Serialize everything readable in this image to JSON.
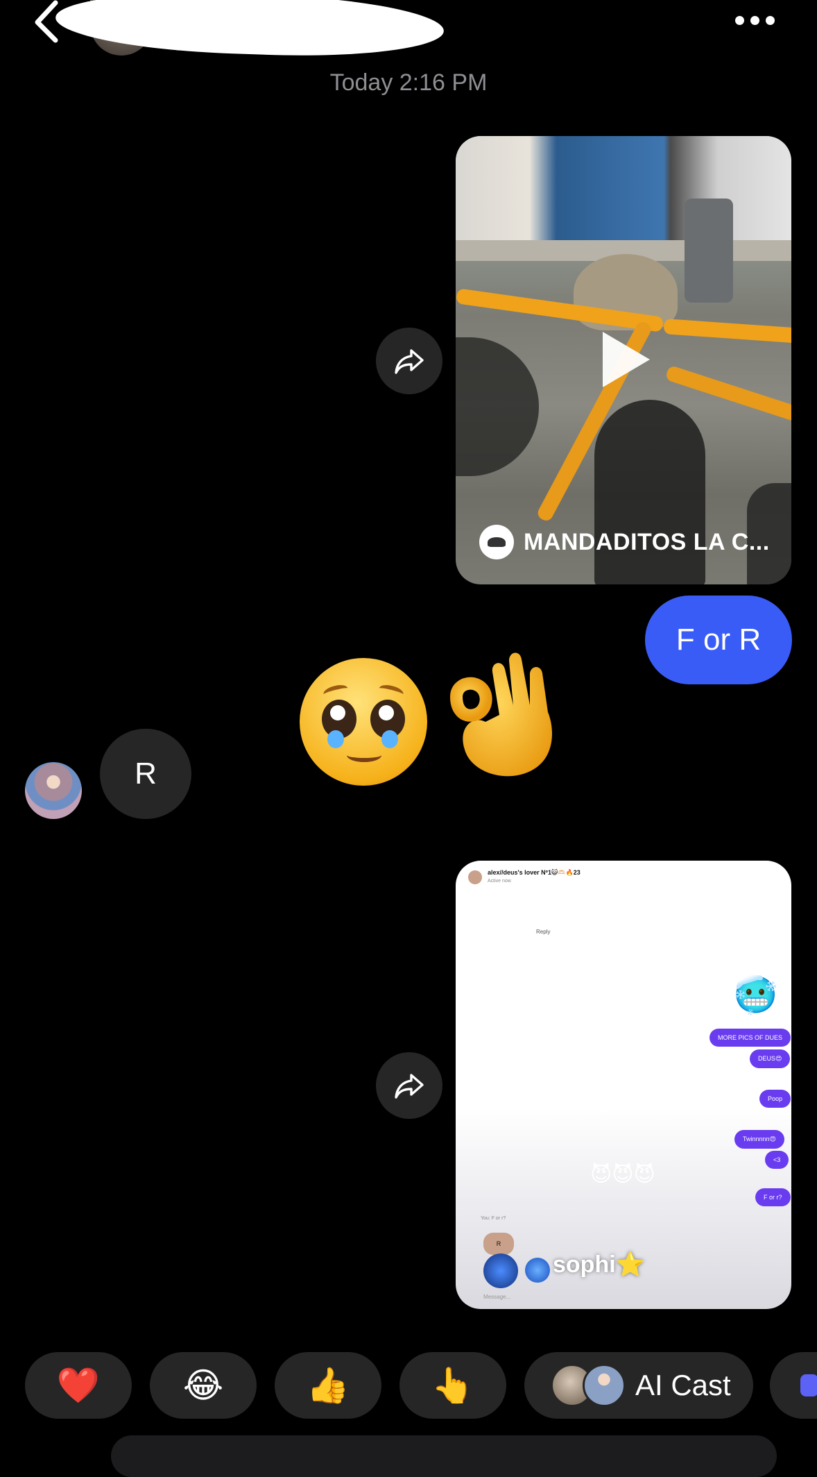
{
  "header": {
    "back_icon": "chevron-left-icon",
    "more_icon": "more-horizontal-icon"
  },
  "timestamp": "Today 2:16 PM",
  "messages": {
    "video_share": {
      "caption": "MANDADITOS LA C...",
      "share_icon": "share-arrow-icon",
      "play_icon": "play-icon"
    },
    "sent_text": "F or R",
    "reaction_emojis": [
      "🥺",
      "👌"
    ],
    "received_text": "R",
    "screenshot_share": {
      "header_name": "alex//deus's lover Nº1😺🫶🏻🔥23",
      "header_status": "Active now",
      "reply_label": "Reply",
      "pills": [
        "MORE PICS OF DUES",
        "DEUS😍",
        "Poop",
        "Twinnnnn😍",
        "<3",
        "F or r?"
      ],
      "reply_preview": "You: F or r?",
      "reply_bubble": "R",
      "composer_placeholder": "Message...",
      "overlay_label": "sophi⭐️",
      "share_icon": "share-arrow-icon",
      "play_icon": "play-icon"
    }
  },
  "reactions_bar": {
    "items": [
      "❤️",
      "😂",
      "👍",
      "👆"
    ],
    "ai_cast_label": "AI Cast"
  },
  "colors": {
    "background": "#000000",
    "sent_bubble": "#3a5cf6",
    "received_bubble": "#262626",
    "timestamp": "#8e8e93"
  }
}
